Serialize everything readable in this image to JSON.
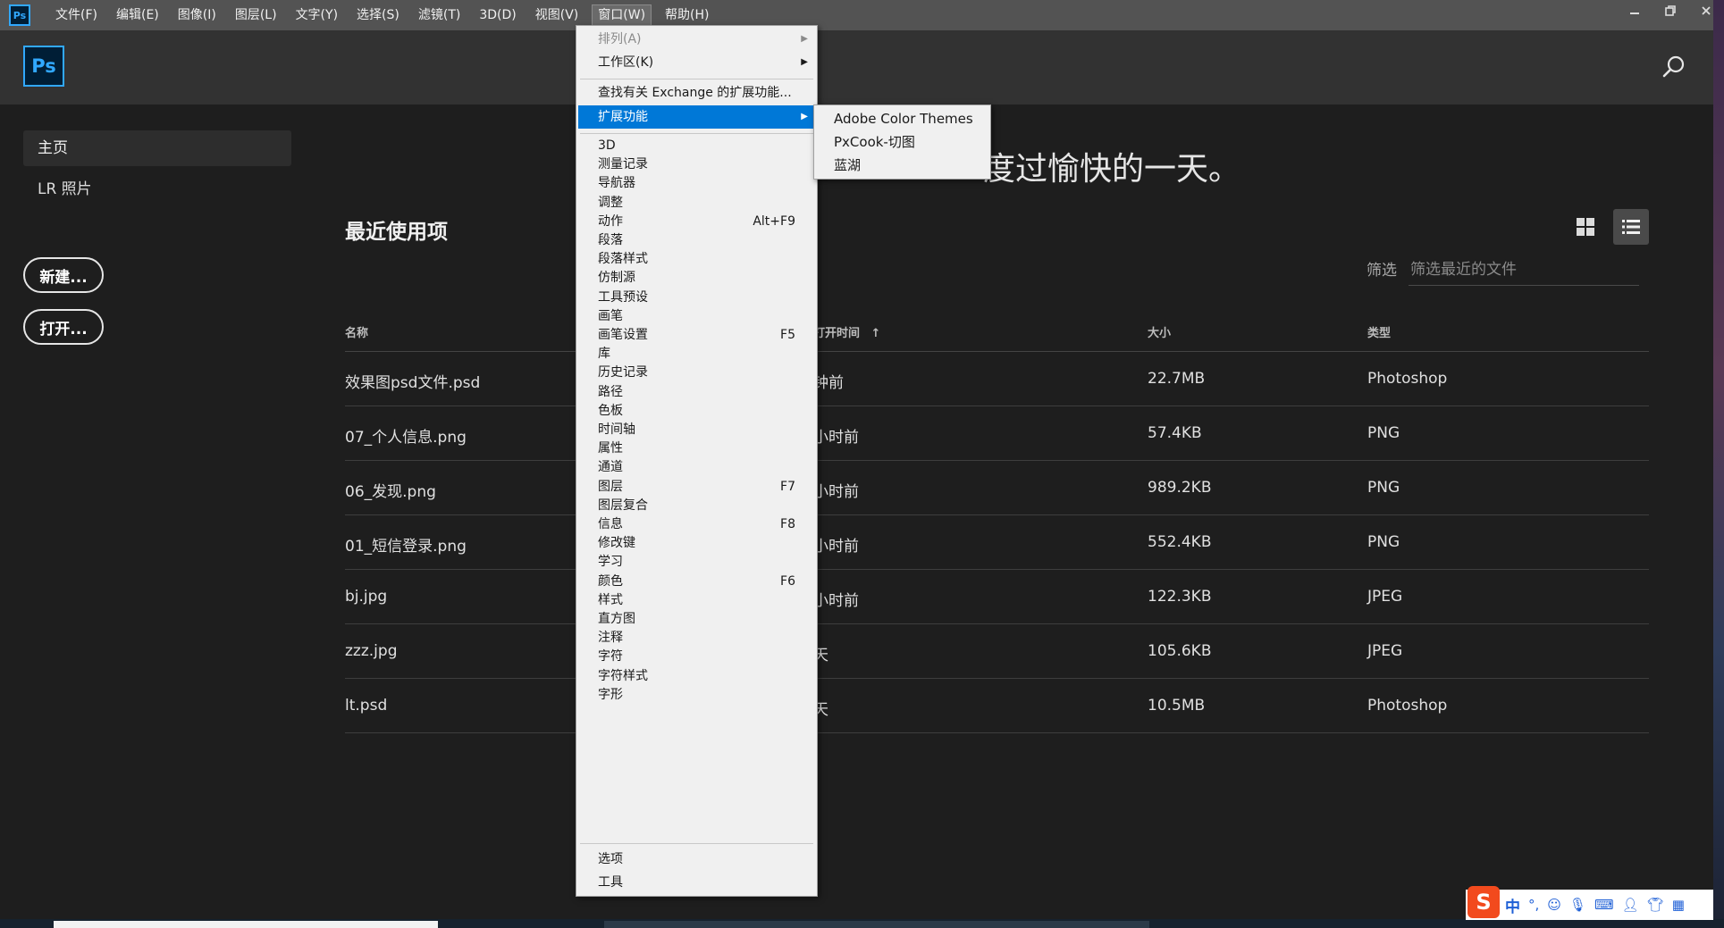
{
  "app_icon": "Ps",
  "menubar": {
    "items": [
      "文件(F)",
      "编辑(E)",
      "图像(I)",
      "图层(L)",
      "文字(Y)",
      "选择(S)",
      "滤镜(T)",
      "3D(D)",
      "视图(V)",
      "窗口(W)",
      "帮助(H)"
    ],
    "active_index": 9
  },
  "window_controls": {
    "minimize": "minimize-icon",
    "restore": "restore-icon",
    "close": "close-icon"
  },
  "header": {
    "logo": "Ps",
    "search_icon": "search-icon"
  },
  "sidebar": {
    "home": "主页",
    "lr_photos": "LR 照片",
    "new_button": "新建...",
    "open_button": "打开..."
  },
  "main": {
    "greeting": "度过愉快的一天。",
    "recent_title": "最近使用项",
    "filter_label": "筛选",
    "filter_placeholder": "筛选最近的文件",
    "view_toggle": {
      "grid_icon": "grid-view-icon",
      "list_icon": "list-view-icon"
    },
    "columns": {
      "name": "名称",
      "opened": "打开时间",
      "size": "大小",
      "type": "类型"
    },
    "rows": [
      {
        "name": "效果图psd文件.psd",
        "opened": "钟前",
        "size": "22.7MB",
        "type": "Photoshop"
      },
      {
        "name": "07_个人信息.png",
        "opened": "小时前",
        "size": "57.4KB",
        "type": "PNG"
      },
      {
        "name": "06_发现.png",
        "opened": "小时前",
        "size": "989.2KB",
        "type": "PNG"
      },
      {
        "name": "01_短信登录.png",
        "opened": "小时前",
        "size": "552.4KB",
        "type": "PNG"
      },
      {
        "name": "bj.jpg",
        "opened": "小时前",
        "size": "122.3KB",
        "type": "JPEG"
      },
      {
        "name": "zzz.jpg",
        "opened": "天",
        "size": "105.6KB",
        "type": "JPEG"
      },
      {
        "name": "lt.psd",
        "opened": "天",
        "size": "10.5MB",
        "type": "Photoshop"
      }
    ]
  },
  "window_menu": {
    "arrange": "排列(A)",
    "workspace": "工作区(K)",
    "exchange": "查找有关 Exchange 的扩展功能...",
    "extensions": "扩展功能",
    "panels": [
      {
        "label": "3D",
        "shortcut": ""
      },
      {
        "label": "测量记录",
        "shortcut": ""
      },
      {
        "label": "导航器",
        "shortcut": ""
      },
      {
        "label": "调整",
        "shortcut": ""
      },
      {
        "label": "动作",
        "shortcut": "Alt+F9"
      },
      {
        "label": "段落",
        "shortcut": ""
      },
      {
        "label": "段落样式",
        "shortcut": ""
      },
      {
        "label": "仿制源",
        "shortcut": ""
      },
      {
        "label": "工具预设",
        "shortcut": ""
      },
      {
        "label": "画笔",
        "shortcut": ""
      },
      {
        "label": "画笔设置",
        "shortcut": "F5"
      },
      {
        "label": "库",
        "shortcut": ""
      },
      {
        "label": "历史记录",
        "shortcut": ""
      },
      {
        "label": "路径",
        "shortcut": ""
      },
      {
        "label": "色板",
        "shortcut": ""
      },
      {
        "label": "时间轴",
        "shortcut": ""
      },
      {
        "label": "属性",
        "shortcut": ""
      },
      {
        "label": "通道",
        "shortcut": ""
      },
      {
        "label": "图层",
        "shortcut": "F7"
      },
      {
        "label": "图层复合",
        "shortcut": ""
      },
      {
        "label": "信息",
        "shortcut": "F8"
      },
      {
        "label": "修改键",
        "shortcut": ""
      },
      {
        "label": "学习",
        "shortcut": ""
      },
      {
        "label": "颜色",
        "shortcut": "F6"
      },
      {
        "label": "样式",
        "shortcut": ""
      },
      {
        "label": "直方图",
        "shortcut": ""
      },
      {
        "label": "注释",
        "shortcut": ""
      },
      {
        "label": "字符",
        "shortcut": ""
      },
      {
        "label": "字符样式",
        "shortcut": ""
      },
      {
        "label": "字形",
        "shortcut": ""
      }
    ],
    "options": "选项",
    "tools": "工具"
  },
  "extensions_submenu": [
    "Adobe Color Themes",
    "PxCook-切图",
    "蓝湖"
  ],
  "ime": {
    "logo": "S",
    "lang": "中"
  },
  "colors": {
    "menubar": "#535353",
    "header": "#323232",
    "background": "#1e1e1e",
    "ps_blue": "#31a8ff",
    "highlight": "#0078d7",
    "menu_bg": "#f0f0f0"
  }
}
